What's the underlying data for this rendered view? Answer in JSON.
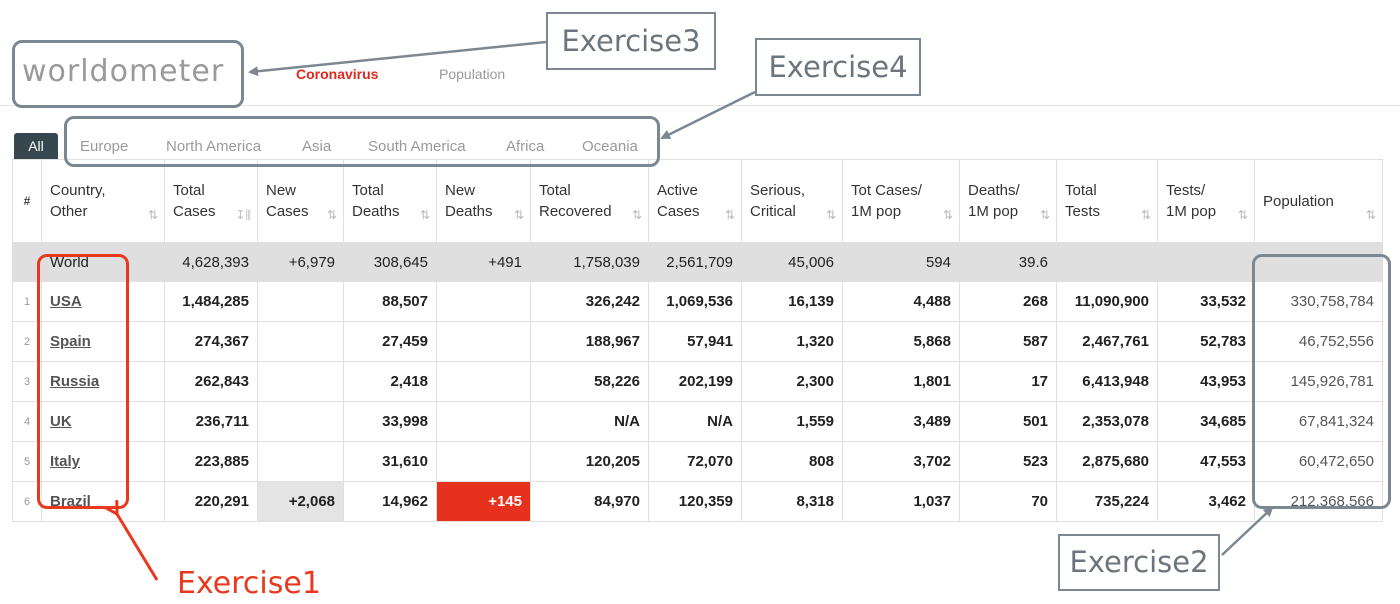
{
  "header": {
    "logo": "worldometer",
    "nav": [
      "Coronavirus",
      "Population"
    ]
  },
  "regions": [
    "All",
    "Europe",
    "North America",
    "Asia",
    "South America",
    "Africa",
    "Oceania"
  ],
  "table": {
    "headers": [
      {
        "l1": "#",
        "l2": ""
      },
      {
        "l1": "Country,",
        "l2": "Other"
      },
      {
        "l1": "Total",
        "l2": "Cases"
      },
      {
        "l1": "New",
        "l2": "Cases"
      },
      {
        "l1": "Total",
        "l2": "Deaths"
      },
      {
        "l1": "New",
        "l2": "Deaths"
      },
      {
        "l1": "Total",
        "l2": "Recovered"
      },
      {
        "l1": "Active",
        "l2": "Cases"
      },
      {
        "l1": "Serious,",
        "l2": "Critical"
      },
      {
        "l1": "Tot Cases/",
        "l2": "1M pop"
      },
      {
        "l1": "Deaths/",
        "l2": "1M pop"
      },
      {
        "l1": "Total",
        "l2": "Tests"
      },
      {
        "l1": "Tests/",
        "l2": "1M pop"
      },
      {
        "l1": "Population",
        "l2": ""
      }
    ],
    "world": [
      "",
      "World",
      "4,628,393",
      "+6,979",
      "308,645",
      "+491",
      "1,758,039",
      "2,561,709",
      "45,006",
      "594",
      "39.6",
      "",
      "",
      ""
    ],
    "rows": [
      [
        "1",
        "USA",
        "1,484,285",
        "",
        "88,507",
        "",
        "326,242",
        "1,069,536",
        "16,139",
        "4,488",
        "268",
        "11,090,900",
        "33,532",
        "330,758,784"
      ],
      [
        "2",
        "Spain",
        "274,367",
        "",
        "27,459",
        "",
        "188,967",
        "57,941",
        "1,320",
        "5,868",
        "587",
        "2,467,761",
        "52,783",
        "46,752,556"
      ],
      [
        "3",
        "Russia",
        "262,843",
        "",
        "2,418",
        "",
        "58,226",
        "202,199",
        "2,300",
        "1,801",
        "17",
        "6,413,948",
        "43,953",
        "145,926,781"
      ],
      [
        "4",
        "UK",
        "236,711",
        "",
        "33,998",
        "",
        "N/A",
        "N/A",
        "1,559",
        "3,489",
        "501",
        "2,353,078",
        "34,685",
        "67,841,324"
      ],
      [
        "5",
        "Italy",
        "223,885",
        "",
        "31,610",
        "",
        "120,205",
        "72,070",
        "808",
        "3,702",
        "523",
        "2,875,680",
        "47,553",
        "60,472,650"
      ],
      [
        "6",
        "Brazil",
        "220,291",
        "+2,068",
        "14,962",
        "+145",
        "84,970",
        "120,359",
        "8,318",
        "1,037",
        "70",
        "735,224",
        "3,462",
        "212,368,566"
      ]
    ]
  },
  "annotations": {
    "exercise1": "Exercise1",
    "exercise2": "Exercise2",
    "exercise3": "Exercise3",
    "exercise4": "Exercise4",
    "colors": {
      "red": "#e8391f",
      "gray": "#7c8891",
      "new_deaths": "#e6311c"
    }
  }
}
